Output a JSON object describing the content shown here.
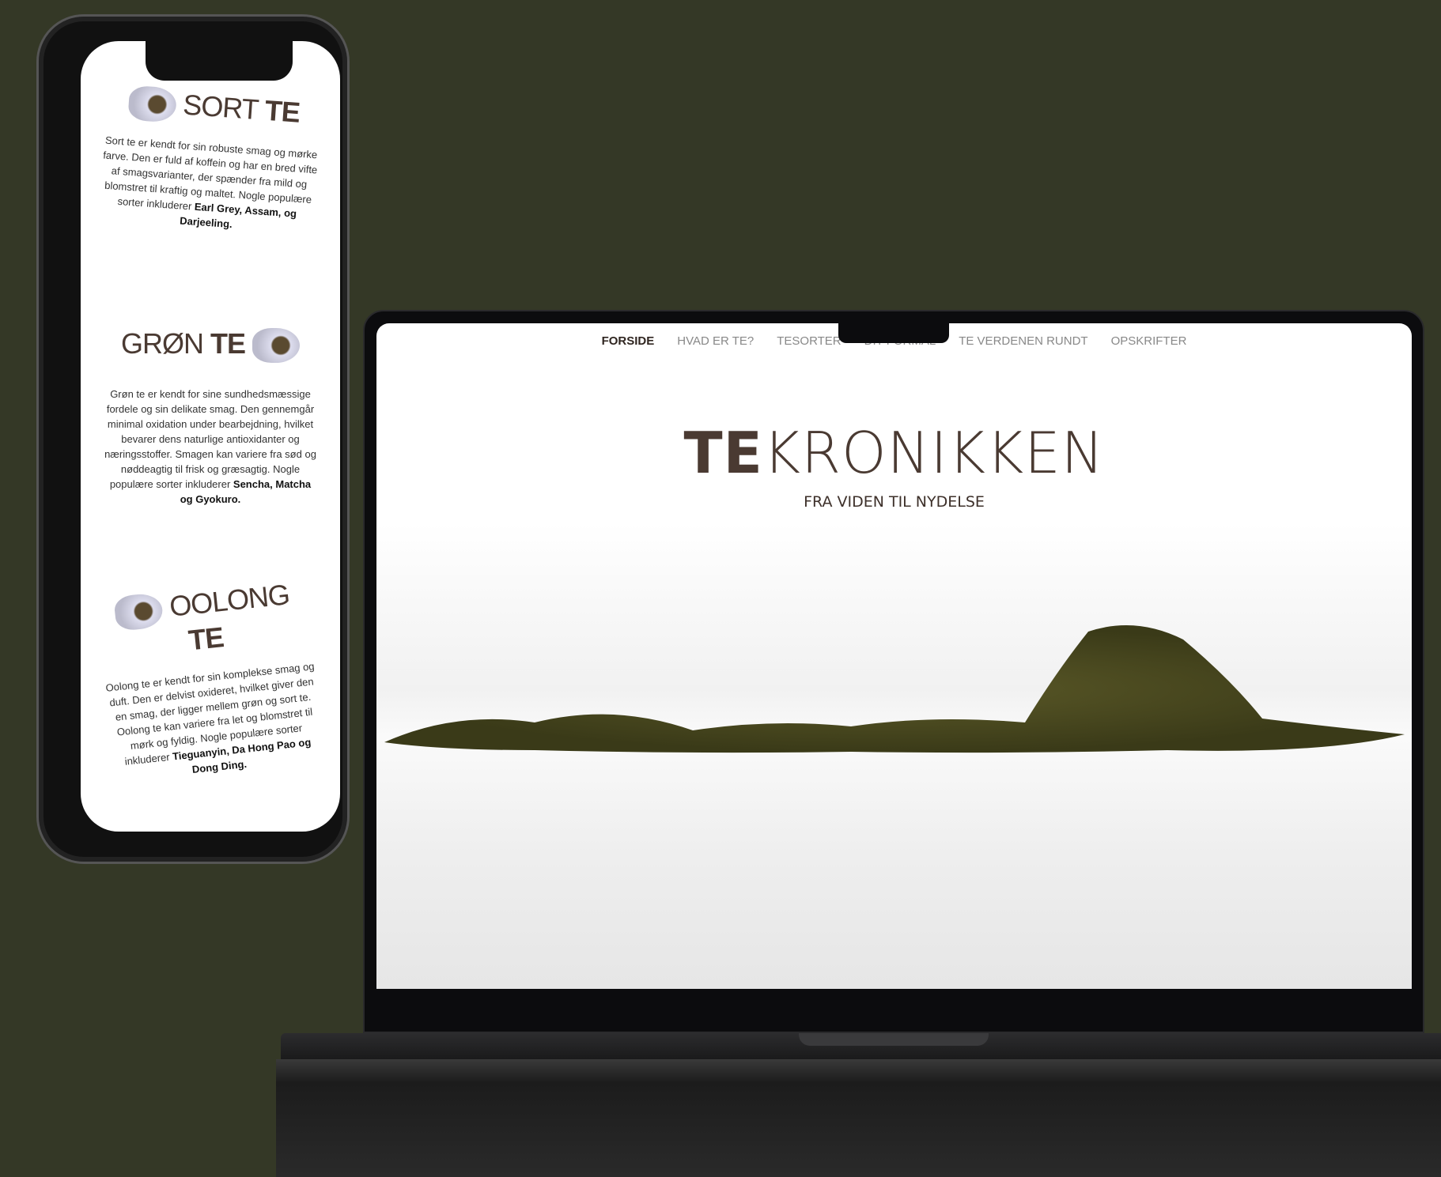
{
  "laptop": {
    "nav": [
      "FORSIDE",
      "HVAD ER TE?",
      "TESORTER",
      "DIT FORMÅL",
      "TE VERDENEN RUNDT",
      "OPSKRIFTER"
    ],
    "title_bold": "TE",
    "title_rest": "KRONIKKEN",
    "subtitle": "FRA VIDEN TIL NYDELSE"
  },
  "phone": {
    "sections": [
      {
        "title": "SORT",
        "title_bold": "TE",
        "text": "Sort te er kendt for sin robuste smag og mørke farve. Den er fuld af koffein og har en bred vifte af smagsvarianter, der spænder fra mild og blomstret til kraftig og maltet. Nogle populære sorter inkluderer ",
        "bold": "Earl Grey, Assam, og Darjeeling."
      },
      {
        "title": "GRØN",
        "title_bold": "TE",
        "text": "Grøn te er kendt for sine sundhedsmæssige fordele og sin delikate smag. Den gennemgår minimal oxidation under bearbejdning, hvilket bevarer dens naturlige antioxidanter og næringsstoffer. Smagen kan variere fra sød og nøddeagtig til frisk og græsagtig. Nogle populære sorter inkluderer ",
        "bold": "Sencha, Matcha og Gyokuro."
      },
      {
        "title": "OOLONG",
        "title_bold": "TE",
        "text": "Oolong te er kendt for sin komplekse smag og duft. Den er delvist oxideret, hvilket giver den en smag, der ligger mellem grøn og sort te. Oolong te kan variere fra let og blomstret til mørk og fyldig. Nogle populære sorter inkluderer ",
        "bold": "Tieguanyin, Da Hong Pao og Dong Ding."
      }
    ]
  }
}
